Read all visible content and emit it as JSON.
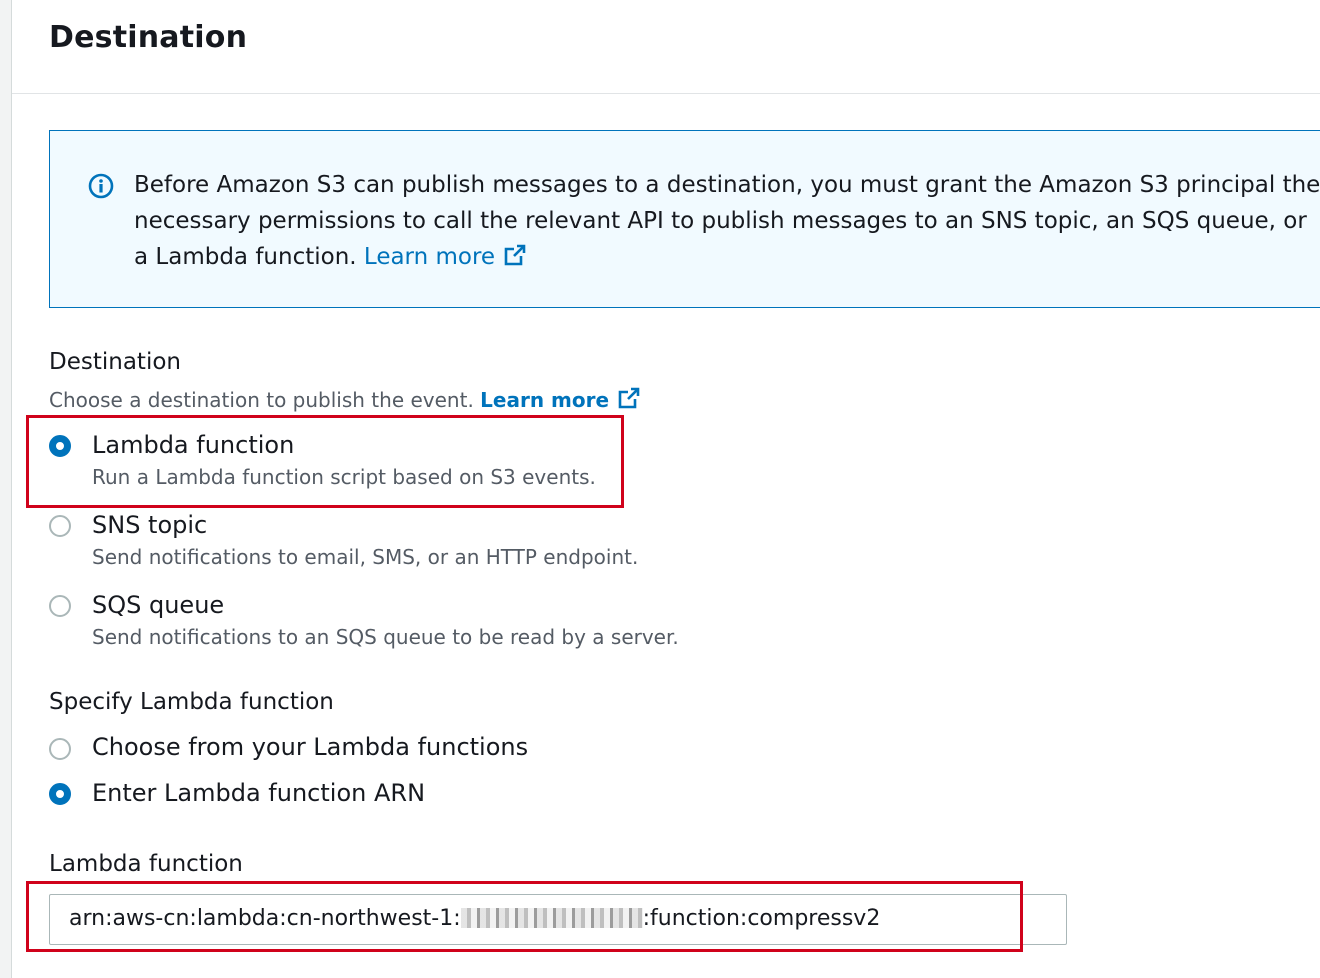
{
  "header": {
    "title": "Destination"
  },
  "info": {
    "icon": "info-icon",
    "text": "Before Amazon S3 can publish messages to a destination, you must grant the Amazon S3 principal the necessary permissions to call the relevant API to publish messages to an SNS topic, an SQS queue, or a Lambda function.",
    "link_label": "Learn more"
  },
  "destination": {
    "label": "Destination",
    "description": "Choose a destination to publish the event.",
    "link_label": "Learn more",
    "options": [
      {
        "title": "Lambda function",
        "description": "Run a Lambda function script based on S3 events.",
        "selected": true
      },
      {
        "title": "SNS topic",
        "description": "Send notifications to email, SMS, or an HTTP endpoint.",
        "selected": false
      },
      {
        "title": "SQS queue",
        "description": "Send notifications to an SQS queue to be read by a server.",
        "selected": false
      }
    ]
  },
  "specify": {
    "label": "Specify Lambda function",
    "options": [
      {
        "title": "Choose from your Lambda functions",
        "selected": false
      },
      {
        "title": "Enter Lambda function ARN",
        "selected": true
      }
    ]
  },
  "lambda_field": {
    "label": "Lambda function",
    "value_prefix": "arn:aws-cn:lambda:cn-northwest-1:",
    "value_suffix": ":function:compressv2"
  },
  "colors": {
    "accent": "#0073bb",
    "highlight": "#d0021b",
    "info_bg": "#f1faff"
  }
}
